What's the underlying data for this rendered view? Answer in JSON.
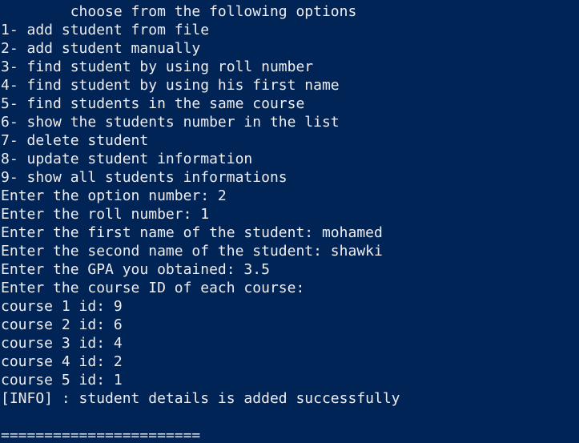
{
  "console": {
    "lines": [
      "        choose from the following options",
      "1- add student from file",
      "2- add student manually",
      "3- find student by using roll number",
      "4- find student by using his first name",
      "5- find students in the same course",
      "6- show the students number in the list",
      "7- delete student",
      "8- update student information",
      "9- show all students informations",
      "Enter the option number: 2",
      "Enter the roll number: 1",
      "Enter the first name of the student: mohamed",
      "Enter the second name of the student: shawki",
      "Enter the GPA you obtained: 3.5",
      "Enter the course ID of each course:",
      "course 1 id: 9",
      "course 2 id: 6",
      "course 3 id: 4",
      "course 4 id: 2",
      "course 5 id: 1",
      "[INFO] : student details is added successfully",
      "",
      "======================="
    ]
  },
  "colors": {
    "background": "#012456",
    "foreground": "#eeedf0"
  }
}
